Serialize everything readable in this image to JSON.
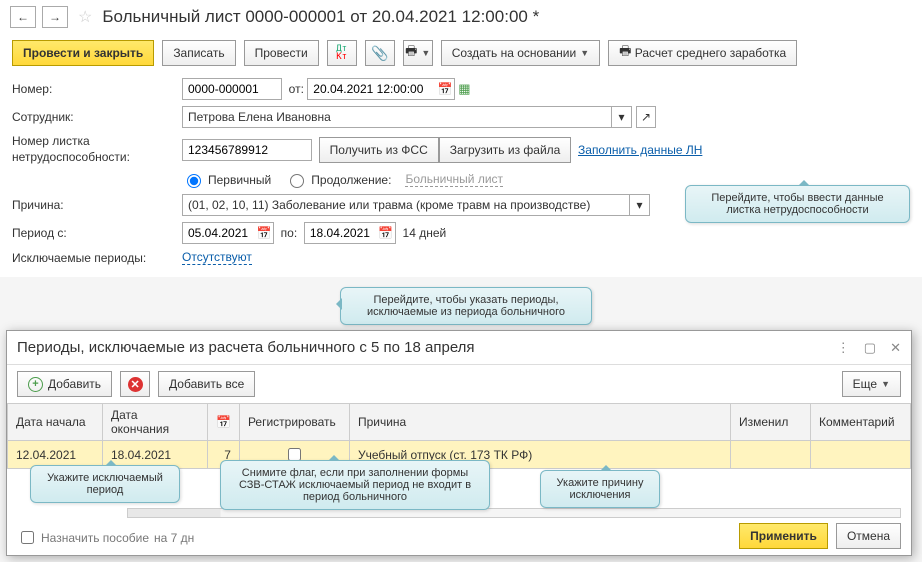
{
  "header": {
    "title": "Больничный лист 0000-000001 от 20.04.2021 12:00:00 *"
  },
  "toolbar": {
    "post_close": "Провести и закрыть",
    "save": "Записать",
    "post": "Провести",
    "create_based": "Создать на основании",
    "calc_avg": "Расчет среднего заработка"
  },
  "form": {
    "number_label": "Номер:",
    "number_value": "0000-000001",
    "from_label": "от:",
    "date_value": "20.04.2021 12:00:00",
    "employee_label": "Сотрудник:",
    "employee_value": "Петрова Елена Ивановна",
    "cert_number_label": "Номер листка нетрудоспособности:",
    "cert_number_value": "123456789912",
    "get_fss": "Получить из ФСС",
    "load_from_file": "Загрузить из файла",
    "fill_ln": "Заполнить данные ЛН",
    "radio_primary": "Первичный",
    "radio_continue": "Продолжение:",
    "continue_link": "Больничный лист",
    "reason_label": "Причина:",
    "reason_value": "(01, 02, 10, 11) Заболевание или травма (кроме травм на производстве)",
    "period_label": "Период с:",
    "period_from": "05.04.2021",
    "period_to_label": "по:",
    "period_to": "18.04.2021",
    "days_text": "14 дней",
    "excluded_label": "Исключаемые периоды:",
    "excluded_link": "Отсутствуют"
  },
  "callouts": {
    "ln": "Перейдите, чтобы ввести данные листка нетрудоспособности",
    "exc": "Перейдите, чтобы указать периоды, исключаемые из периода больничного",
    "b1": "Укажите исключаемый период",
    "b2": "Снимите флаг, если при заполнении формы СЗВ-СТАЖ исключаемый период не входит в период больничного",
    "b3": "Укажите причину исключения"
  },
  "subwindow": {
    "title": "Периоды, исключаемые из расчета больничного с 5 по 18 апреля",
    "add": "Добавить",
    "add_all": "Добавить все",
    "more": "Еще",
    "columns": {
      "start": "Дата начала",
      "end": "Дата окончания",
      "days": "",
      "register": "Регистрировать",
      "reason": "Причина",
      "changed": "Изменил",
      "comment": "Комментарий"
    },
    "row": {
      "start": "12.04.2021",
      "end": "18.04.2021",
      "days": "7",
      "reason": "Учебный отпуск (ст. 173 ТК РФ)"
    },
    "assign_label": "Назначить пособие",
    "assign_days": "на 7 дн",
    "apply": "Применить",
    "cancel": "Отмена"
  }
}
